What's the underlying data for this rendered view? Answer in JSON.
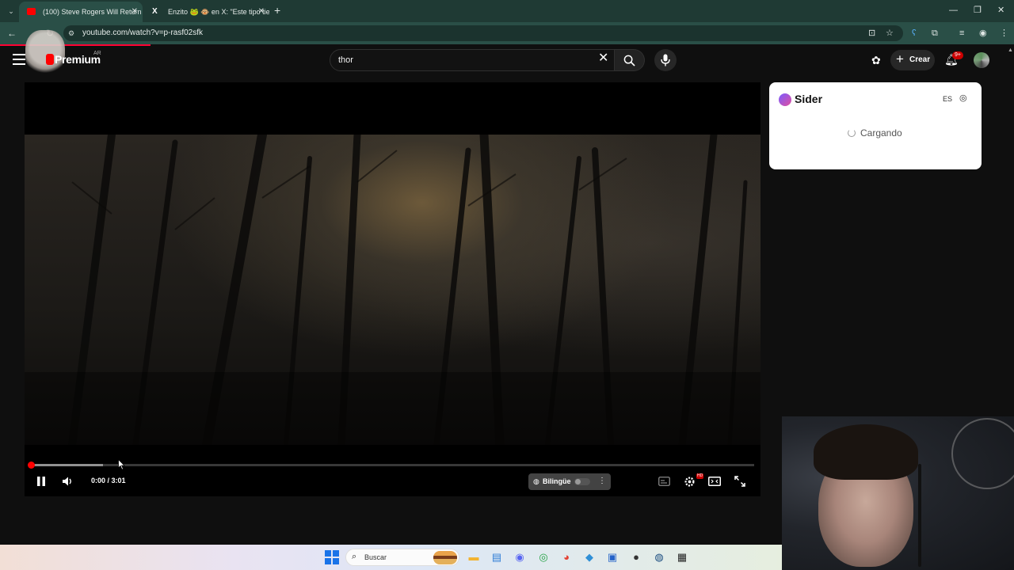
{
  "browser": {
    "tabs": [
      {
        "title": "(100) Steve Rogers Will Return |",
        "active": true
      },
      {
        "title": "Enzito 🐸 🐵 en X: \"Este tipo tie",
        "active": false
      }
    ],
    "url": "youtube.com/watch?v=p-rasf02sfk"
  },
  "youtube": {
    "brand": "Premium",
    "country": "AR",
    "search_value": "thor",
    "create_label": "Crear",
    "notifications_badge": "9+"
  },
  "player": {
    "time": "0:00 / 3:01",
    "progress_fraction": 0.0,
    "buffered_fraction": 0.1,
    "bilingual_label": "Bilingüe",
    "settings_badge": "HD"
  },
  "sider": {
    "name": "Sider",
    "lang": "ES",
    "loading_text": "Cargando"
  },
  "taskbar": {
    "search_label": "Buscar",
    "apps": [
      "file-explorer-icon",
      "notepad-icon",
      "discord-icon",
      "whatsapp-icon",
      "chrome-icon",
      "kodi-icon",
      "store-icon",
      "obs-icon",
      "steam-icon",
      "app-icon"
    ]
  },
  "colors": {
    "chrome_frame": "#1f3a34",
    "chrome_toolbar": "#2a4f47",
    "youtube_red": "#ff0000",
    "page_bg": "#0f0f0f"
  }
}
